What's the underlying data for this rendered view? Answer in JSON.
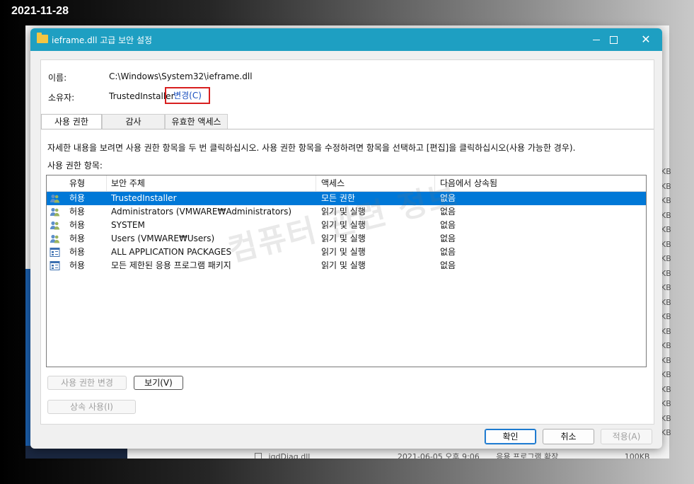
{
  "date_stamp": "2021-11-28",
  "background": {
    "kb_labels": [
      "KB",
      "KB",
      "KB",
      "KB",
      "KB",
      "KB",
      "KB",
      "KB",
      "KB",
      "KB",
      "KB",
      "KB",
      "KB",
      "KB",
      "KB",
      "KB",
      "KB",
      "KB",
      "KB"
    ],
    "bottom_file": "igdDiag.dll",
    "bottom_date": "2021-06-05 오후 9:06",
    "bottom_type": "응용 프로그램 확장",
    "bottom_size": "100KB"
  },
  "dialog": {
    "title": "ieframe.dll 고급 보안 설정",
    "controls": {
      "minimize": "",
      "maximize": "",
      "close": "✕"
    },
    "name_label": "이름:",
    "name_value": "C:\\Windows\\System32\\ieframe.dll",
    "owner_label": "소유자:",
    "owner_value": "TrustedInstaller",
    "change_link": "변경(C)",
    "tabs": [
      {
        "label": "사용 권한",
        "active": true
      },
      {
        "label": "감사",
        "active": false
      },
      {
        "label": "유효한 액세스",
        "active": false
      }
    ],
    "description": "자세한 내용을 보려면 사용 권한 항목을 두 번 클릭하십시오. 사용 권한 항목을 수정하려면 항목을 선택하고 [편집]을 클릭하십시오(사용 가능한 경우).",
    "entries_label": "사용 권한 항목:",
    "columns": [
      "유형",
      "보안 주체",
      "액세스",
      "다음에서 상속됨"
    ],
    "entries": [
      {
        "icon": "user-group-icon",
        "type": "허용",
        "principal": "TrustedInstaller",
        "access": "모든 권한",
        "inherited": "없음",
        "selected": true
      },
      {
        "icon": "user-group-icon",
        "type": "허용",
        "principal": "Administrators (VMWARE₩Administrators)",
        "access": "읽기 및 실행",
        "inherited": "없음",
        "selected": false
      },
      {
        "icon": "user-group-icon",
        "type": "허용",
        "principal": "SYSTEM",
        "access": "읽기 및 실행",
        "inherited": "없음",
        "selected": false
      },
      {
        "icon": "user-group-icon",
        "type": "허용",
        "principal": "Users (VMWARE₩Users)",
        "access": "읽기 및 실행",
        "inherited": "없음",
        "selected": false
      },
      {
        "icon": "app-package-icon",
        "type": "허용",
        "principal": "ALL APPLICATION PACKAGES",
        "access": "읽기 및 실행",
        "inherited": "없음",
        "selected": false
      },
      {
        "icon": "app-package-icon",
        "type": "허용",
        "principal": "모든 제한된 응용 프로그램 패키지",
        "access": "읽기 및 실행",
        "inherited": "없음",
        "selected": false
      }
    ],
    "buttons": {
      "edit": "사용 권한 변경",
      "view": "보기(V)",
      "inherit": "상속 사용(I)",
      "ok": "확인",
      "cancel": "취소",
      "apply": "적용(A)"
    }
  },
  "watermark": "컴퓨터 관련 정보"
}
